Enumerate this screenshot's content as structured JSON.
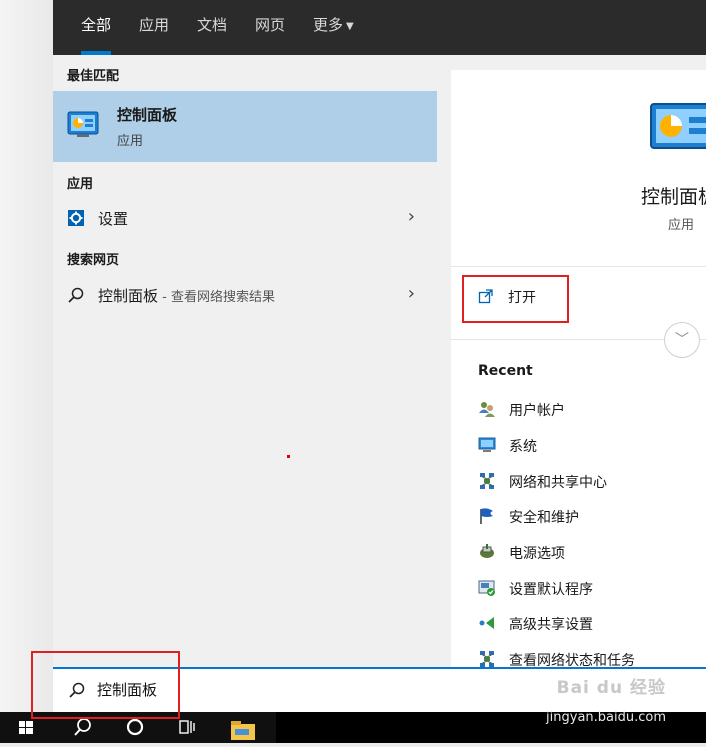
{
  "tabs": [
    {
      "label": "全部",
      "active": true
    },
    {
      "label": "应用",
      "active": false
    },
    {
      "label": "文档",
      "active": false
    },
    {
      "label": "网页",
      "active": false
    },
    {
      "label": "更多",
      "active": false,
      "has_dropdown": true
    }
  ],
  "left": {
    "best_match_header": "最佳匹配",
    "best_match": {
      "title": "控制面板",
      "subtitle": "应用",
      "icon": "control-panel-icon"
    },
    "apps_header": "应用",
    "apps": [
      {
        "label": "设置",
        "icon": "settings-gear-icon"
      }
    ],
    "web_header": "搜索网页",
    "web": [
      {
        "label": "控制面板",
        "hint": " - 查看网络搜索结果",
        "icon": "search-icon"
      }
    ]
  },
  "right": {
    "title": "控制面板",
    "subtitle": "应用",
    "open_label": "打开",
    "recent_header": "Recent",
    "recent_items": [
      {
        "label": "用户帐户",
        "icon": "user-accounts-icon"
      },
      {
        "label": "系统",
        "icon": "system-monitor-icon"
      },
      {
        "label": "网络和共享中心",
        "icon": "network-icon"
      },
      {
        "label": "安全和维护",
        "icon": "flag-icon"
      },
      {
        "label": "电源选项",
        "icon": "power-options-icon"
      },
      {
        "label": "设置默认程序",
        "icon": "default-programs-icon"
      },
      {
        "label": "高级共享设置",
        "icon": "sharing-icon"
      },
      {
        "label": "查看网络状态和任务",
        "icon": "network-icon"
      }
    ]
  },
  "search": {
    "value": "控制面板",
    "watermark": "Bai du 经验"
  },
  "taskbar": {
    "url": "jingyan.baidu.com"
  },
  "colors": {
    "accent": "#0078d4",
    "highlight": "#aecfe7",
    "annotation": "#e02020"
  }
}
